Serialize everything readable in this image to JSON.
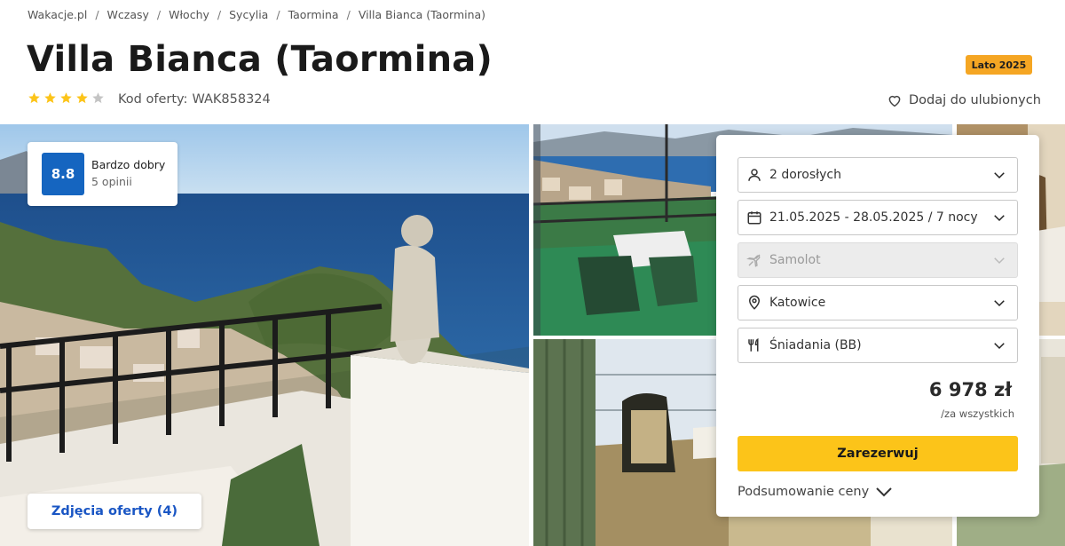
{
  "breadcrumb": [
    {
      "label": "Wakacje.pl"
    },
    {
      "label": "Wczasy"
    },
    {
      "label": "Włochy"
    },
    {
      "label": "Sycylia"
    },
    {
      "label": "Taormina"
    },
    {
      "label": "Villa Bianca (Taormina)"
    }
  ],
  "breadcrumb_separator": "/",
  "hotel": {
    "title": "Villa Bianca (Taormina)",
    "stars": 4,
    "stars_max": 5,
    "offer_code_label": "Kod oferty:",
    "offer_code": "WAK858324",
    "season_badge": "Lato 2025"
  },
  "favorite": {
    "label": "Dodaj do ulubionych",
    "icon": "heart-icon"
  },
  "rating": {
    "score": "8.8",
    "label": "Bardzo dobry",
    "count": "5 opinii"
  },
  "gallery": {
    "photos_button": "Zdjęcia oferty (4)"
  },
  "booking": {
    "guests": {
      "value": "2 dorosłych",
      "icon": "person-icon"
    },
    "dates": {
      "value": "21.05.2025 - 28.05.2025 / 7 nocy",
      "icon": "calendar-icon"
    },
    "transport": {
      "value": "Samolot",
      "icon": "plane-icon",
      "disabled": true
    },
    "departure": {
      "value": "Katowice",
      "icon": "location-pin-icon"
    },
    "board": {
      "value": "Śniadania (BB)",
      "icon": "cutlery-icon"
    },
    "price": "6 978 zł",
    "price_note": "/za wszystkich",
    "book_button": "Zarezerwuj",
    "summary_label": "Podsumowanie ceny"
  },
  "colors": {
    "accent_blue": "#1565c0",
    "link_blue": "#1a56c4",
    "book_yellow": "#fcc419",
    "badge_orange": "#f5a623",
    "star_yellow": "#fcc419",
    "star_grey": "#c4c4c4"
  }
}
